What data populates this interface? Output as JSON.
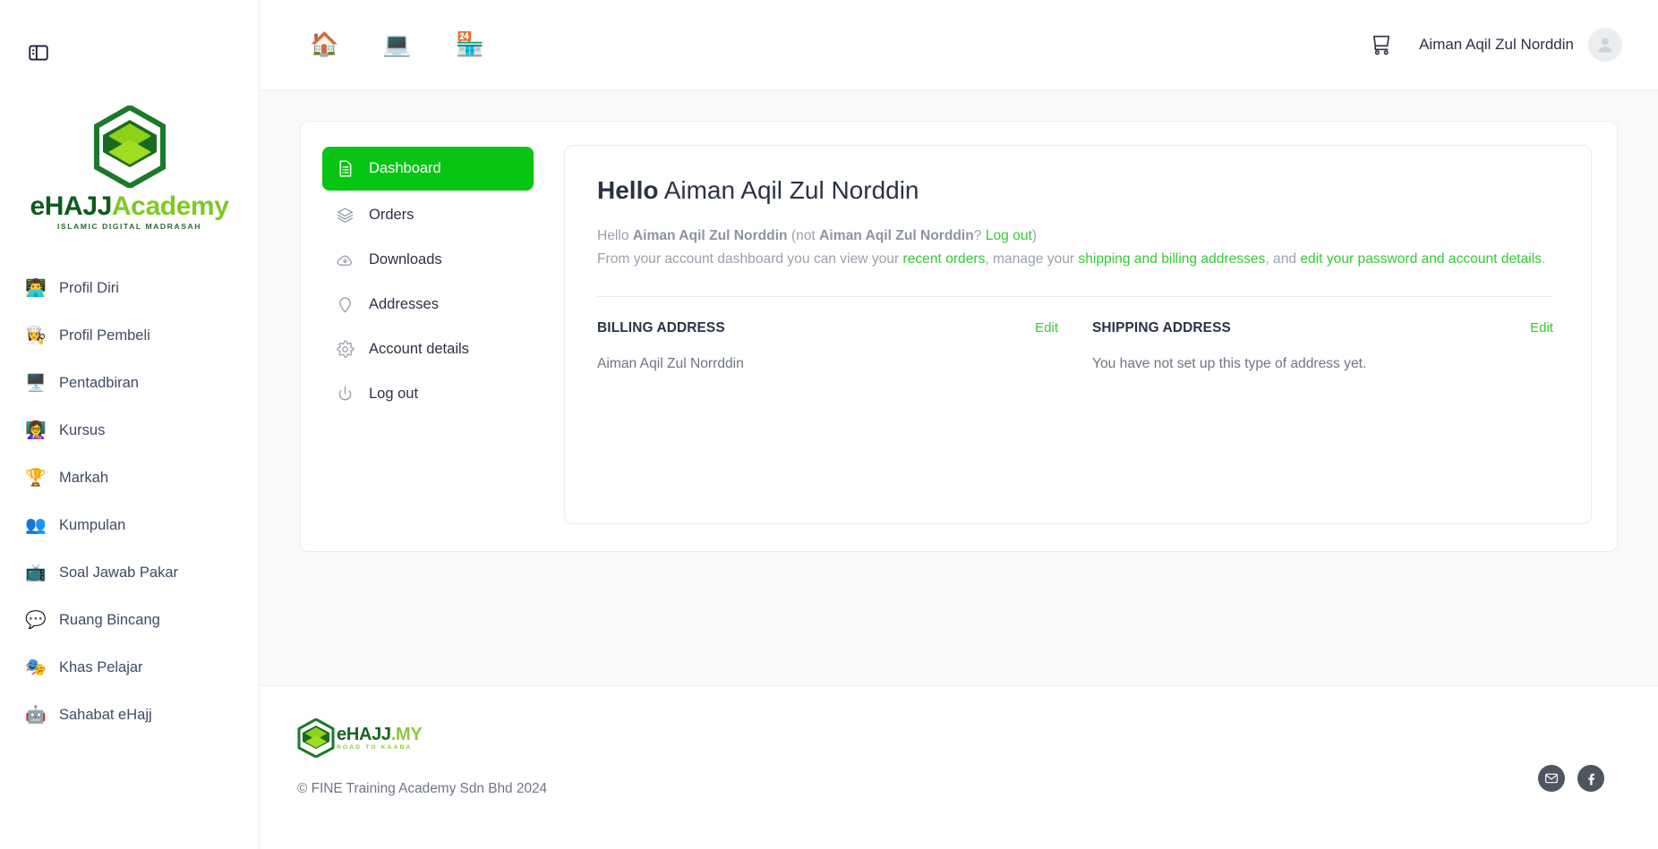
{
  "brand": {
    "logo_line1_dark": "eHAJJ",
    "logo_line1_lime": "Academy",
    "logo_tagline": "ISLAMIC DIGITAL MADRASAH",
    "accent_green": "#08c514",
    "link_green": "#33cc33",
    "logo_dark_green": "#0f5c1e",
    "logo_lime_green": "#7ec924"
  },
  "sidebar": {
    "toggle_icon": "panel-left-icon",
    "items": [
      {
        "label": "Profil Diri",
        "icon": "user-profile-icon",
        "emoji": "👨‍💻"
      },
      {
        "label": "Profil Pembeli",
        "icon": "buyer-profile-icon",
        "emoji": "👩‍🍳"
      },
      {
        "label": "Pentadbiran",
        "icon": "admin-gear-icon",
        "emoji": "🖥️"
      },
      {
        "label": "Kursus",
        "icon": "course-icon",
        "emoji": "👩‍🏫"
      },
      {
        "label": "Markah",
        "icon": "score-icon",
        "emoji": "🏆"
      },
      {
        "label": "Kumpulan",
        "icon": "group-icon",
        "emoji": "👥"
      },
      {
        "label": "Soal Jawab Pakar",
        "icon": "qa-expert-icon",
        "emoji": "📺"
      },
      {
        "label": "Ruang Bincang",
        "icon": "discussion-icon",
        "emoji": "💬"
      },
      {
        "label": "Khas Pelajar",
        "icon": "student-special-icon",
        "emoji": "🎭"
      },
      {
        "label": "Sahabat eHajj",
        "icon": "friends-icon",
        "emoji": "🤖"
      }
    ]
  },
  "topbar": {
    "icons": [
      {
        "name": "home-icon",
        "emoji": "🏠"
      },
      {
        "name": "learn-icon",
        "emoji": "💻"
      },
      {
        "name": "shop-icon",
        "emoji": "🏪"
      }
    ],
    "cart_icon": "shopping-cart-icon",
    "user_name": "Aiman Aqil Zul Norddin",
    "avatar_icon": "user-avatar-icon"
  },
  "account_nav": {
    "items": [
      {
        "label": "Dashboard",
        "icon": "dashboard-list-icon",
        "active": true
      },
      {
        "label": "Orders",
        "icon": "layers-icon",
        "active": false
      },
      {
        "label": "Downloads",
        "icon": "cloud-download-icon",
        "active": false
      },
      {
        "label": "Addresses",
        "icon": "location-pin-icon",
        "active": false
      },
      {
        "label": "Account details",
        "icon": "gear-icon",
        "active": false
      },
      {
        "label": "Log out",
        "icon": "power-icon",
        "active": false
      }
    ]
  },
  "dashboard": {
    "heading_bold": "Hello",
    "heading_name": "Aiman Aqil Zul Norddin",
    "line1_pre": "Hello ",
    "line1_name": "Aiman Aqil Zul Norddin",
    "line1_mid": " (not ",
    "line1_name2": "Aiman Aqil Zul Norddin",
    "line1_q": "? ",
    "line1_logout": "Log out",
    "line1_close": ")",
    "line2_pre": "From your account dashboard you can view your ",
    "line2_link1": "recent orders",
    "line2_mid1": ", manage your ",
    "line2_link2": "shipping and billing addresses",
    "line2_mid2": ", and ",
    "line2_link3": "edit your password and account details",
    "line2_end": "."
  },
  "addresses": {
    "billing": {
      "title": "BILLING ADDRESS",
      "edit_label": "Edit",
      "value": "Aiman Aqil Zul Norrddin"
    },
    "shipping": {
      "title": "SHIPPING ADDRESS",
      "edit_label": "Edit",
      "value": "You have not set up this type of address yet."
    }
  },
  "footer": {
    "logo_t1_dark": "eHAJJ",
    "logo_t1_lime": ".MY",
    "logo_t2": "ROAD TO KAABA",
    "copyright": "© FINE Training Academy Sdn Bhd 2024",
    "social": [
      {
        "name": "email-icon",
        "glyph": "✉"
      },
      {
        "name": "facebook-icon",
        "glyph": "f"
      }
    ]
  }
}
